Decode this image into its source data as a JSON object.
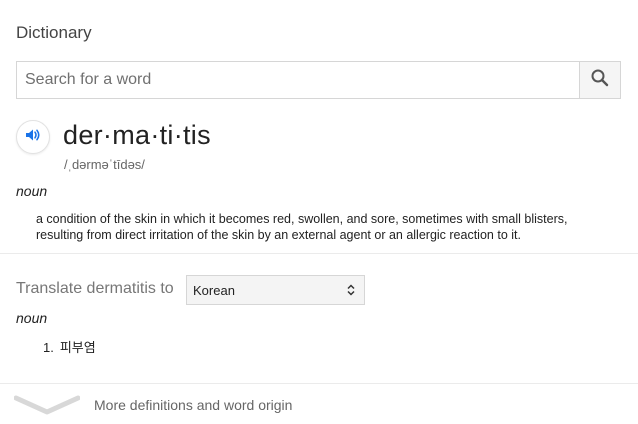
{
  "header": {
    "title": "Dictionary"
  },
  "search": {
    "placeholder": "Search for a word",
    "value": ""
  },
  "entry": {
    "word": "der·ma·ti·tis",
    "phonetic": "/ˌdərməˈtīdəs/",
    "part_of_speech": "noun",
    "definition": "a condition of the skin in which it becomes red, swollen, and sore, sometimes with small blisters, resulting from direct irritation of the skin by an external agent or an allergic reaction to it."
  },
  "translate": {
    "label": "Translate dermatitis to",
    "selected_language": "Korean",
    "part_of_speech": "noun",
    "items": [
      {
        "number": "1.",
        "text": "피부염"
      }
    ]
  },
  "footer": {
    "more_label": "More definitions and word origin"
  },
  "colors": {
    "speaker_blue": "#1a73e8",
    "divider": "#ebebeb",
    "muted_text": "#777777"
  }
}
